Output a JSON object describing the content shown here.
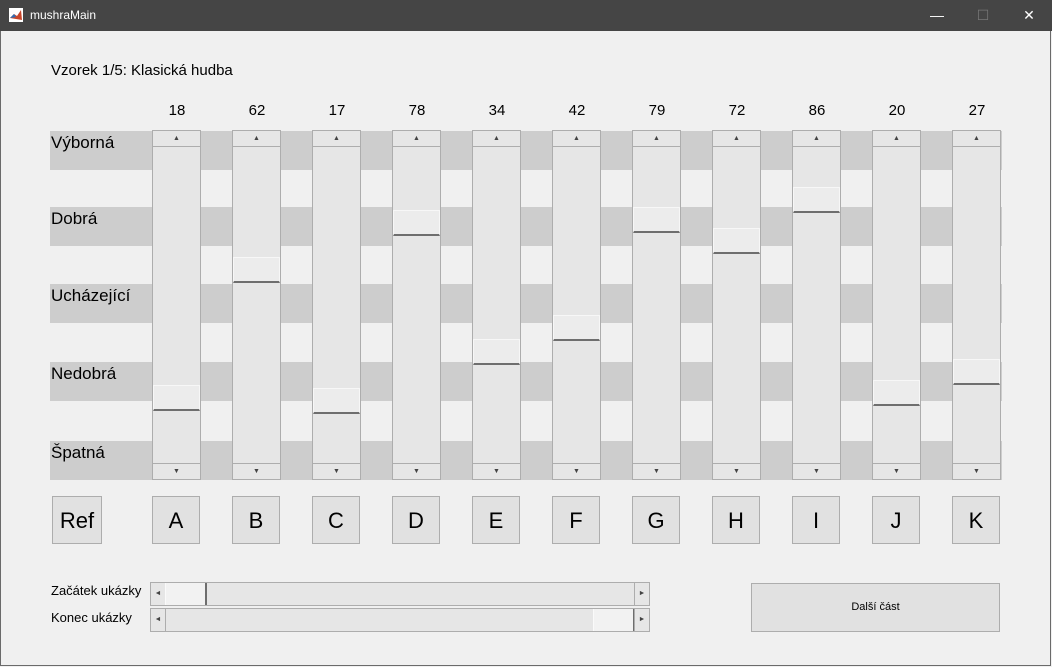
{
  "window": {
    "title": "mushraMain",
    "minimize_glyph": "—",
    "maximize_glyph": "☐",
    "close_glyph": "✕"
  },
  "sample_title": "Vzorek 1/5: Klasická hudba",
  "scale": {
    "min": 0,
    "max": 100
  },
  "ratings": [
    "Výborná",
    "Dobrá",
    "Ucházející",
    "Nedobrá",
    "Špatná"
  ],
  "arrows": {
    "up": "▲",
    "down": "▼",
    "left": "◄",
    "right": "►"
  },
  "ref_button": {
    "label": "Ref"
  },
  "stimuli": [
    {
      "label": "A",
      "score": "18"
    },
    {
      "label": "B",
      "score": "62"
    },
    {
      "label": "C",
      "score": "17"
    },
    {
      "label": "D",
      "score": "78"
    },
    {
      "label": "E",
      "score": "34"
    },
    {
      "label": "F",
      "score": "42"
    },
    {
      "label": "G",
      "score": "79"
    },
    {
      "label": "H",
      "score": "72"
    },
    {
      "label": "I",
      "score": "86"
    },
    {
      "label": "J",
      "score": "20"
    },
    {
      "label": "K",
      "score": "27"
    }
  ],
  "playback": {
    "start_label": "Začátek ukázky",
    "end_label": "Konec ukázky",
    "start_position": 0.0,
    "end_position": 1.0
  },
  "next_button": {
    "label": "Další část"
  },
  "colors": {
    "titlebar": "#454545",
    "band": "#cdcdcd",
    "background": "#f0f0f0"
  }
}
